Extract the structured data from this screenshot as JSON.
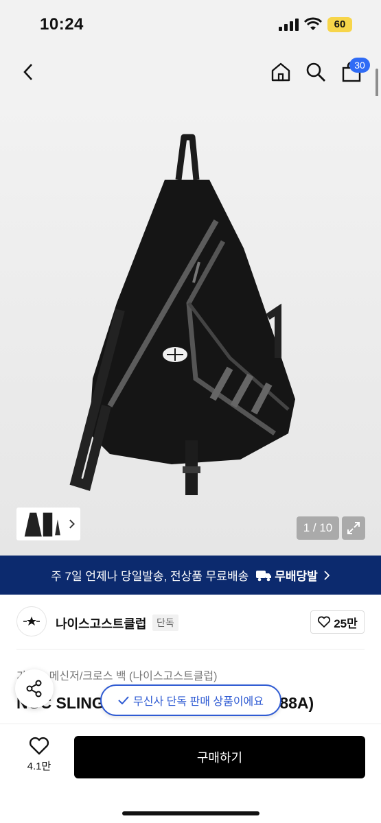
{
  "status": {
    "time": "10:24",
    "battery": "60"
  },
  "nav": {
    "cart_count": "30"
  },
  "gallery": {
    "page": "1 / 10"
  },
  "banner": {
    "text": "주 7일 언제나 당일발송, 전상품 무료배송",
    "brand": "무배당발"
  },
  "brand": {
    "name": "나이스고스트클럽",
    "tag": "단독",
    "likes": "25만"
  },
  "product": {
    "category": "가방 > 메신저/크로스 백 (나이스고스트클럽)",
    "title": "NGC SLING BAG BLACK (NGCJAB88A)"
  },
  "toast": {
    "text": "무신사 단독 판매 상품이에요"
  },
  "bottom": {
    "wish_count": "4.1만",
    "buy_label": "구매하기"
  },
  "colors": {
    "accent": "#2f6bf5",
    "banner": "#0c2a6e",
    "buy": "#000000"
  }
}
